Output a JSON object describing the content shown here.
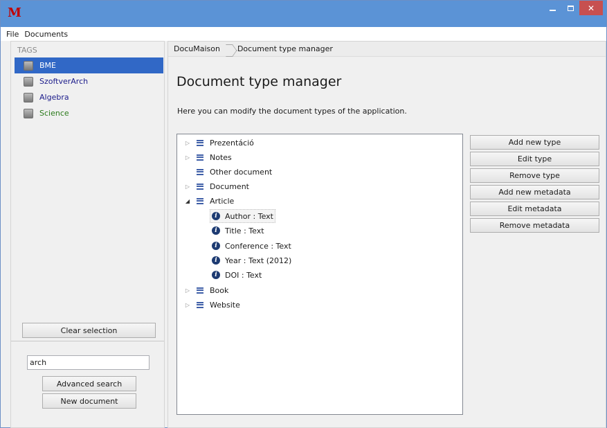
{
  "window": {
    "logo": "M",
    "close_glyph": "✕"
  },
  "menu": [
    "File",
    "Documents"
  ],
  "sidebar": {
    "tags_header": "TAGS",
    "tags": [
      {
        "label": "BME",
        "selected": true,
        "color": "#ffffff"
      },
      {
        "label": "SzoftverArch",
        "selected": false,
        "color": "#1a1a8a"
      },
      {
        "label": "Algebra",
        "selected": false,
        "color": "#1a1a8a"
      },
      {
        "label": "Science",
        "selected": false,
        "color": "#2a7a1a"
      }
    ],
    "clear_selection": "Clear selection",
    "search_value": "arch",
    "advanced_search": "Advanced search",
    "new_document": "New document"
  },
  "breadcrumb": [
    "DocuMaison",
    "Document type manager"
  ],
  "main": {
    "title": "Document type manager",
    "description": "Here you can modify the document types of the application.",
    "tree": [
      {
        "label": "Prezentáció",
        "expandable": true,
        "expanded": false
      },
      {
        "label": "Notes",
        "expandable": true,
        "expanded": false
      },
      {
        "label": "Other document",
        "expandable": false,
        "expanded": false
      },
      {
        "label": "Document",
        "expandable": true,
        "expanded": false
      },
      {
        "label": "Article",
        "expandable": true,
        "expanded": true,
        "metadata": [
          "Author : Text",
          "Title : Text",
          "Conference : Text",
          "Year : Text (2012)",
          "DOI : Text"
        ]
      },
      {
        "label": "Book",
        "expandable": true,
        "expanded": false
      },
      {
        "label": "Website",
        "expandable": true,
        "expanded": false
      }
    ],
    "actions": [
      "Add new type",
      "Edit type",
      "Remove type",
      "Add new metadata",
      "Edit metadata",
      "Remove metadata"
    ]
  },
  "colors": {
    "titlebar": "#5b93d6",
    "selection": "#3168c6",
    "close_button": "#c75050",
    "logo": "#c00000"
  }
}
